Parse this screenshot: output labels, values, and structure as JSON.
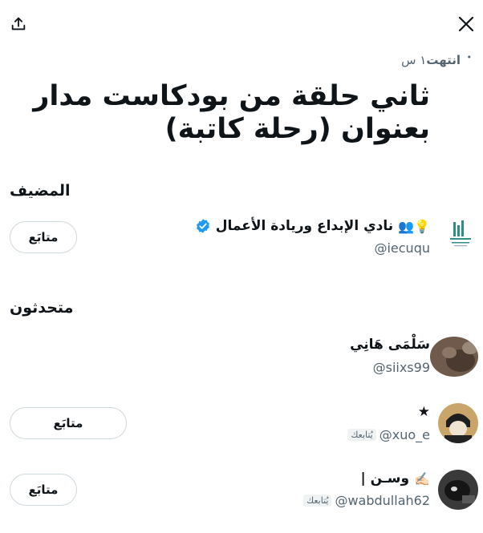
{
  "header": {
    "share_icon": "share-upload-icon",
    "close_icon": "close-x-icon",
    "status_ended": "انتهت",
    "status_time": "١ س"
  },
  "title": "ثاني حلقة من بودكاست مدار بعنوان (رحلة كاتبة)",
  "host_section": {
    "label": "المضيف",
    "user": {
      "name": "نادي الإبداع وريادة الأعمال",
      "emoji": "💡👥",
      "handle": "@iecuqu",
      "verified": true,
      "follow_label": "متابَع"
    }
  },
  "speakers_section": {
    "label": "متحدثون",
    "users": [
      {
        "name": "سَلْمَى هَانِي",
        "handle": "@siixs99"
      },
      {
        "name": "★",
        "handle": "@xuo_e",
        "follows_you": "يُتابعك",
        "follow_label": "متابَع"
      },
      {
        "name": "وسـن |",
        "emoji": "✍🏻",
        "handle": "@wabdullah62",
        "follows_you": "يُتابعك",
        "follow_label": "متابَع"
      }
    ]
  },
  "colors": {
    "text": "#0f1419",
    "muted": "#536471",
    "border": "#cfd9de",
    "verified": "#1d9bf0"
  }
}
